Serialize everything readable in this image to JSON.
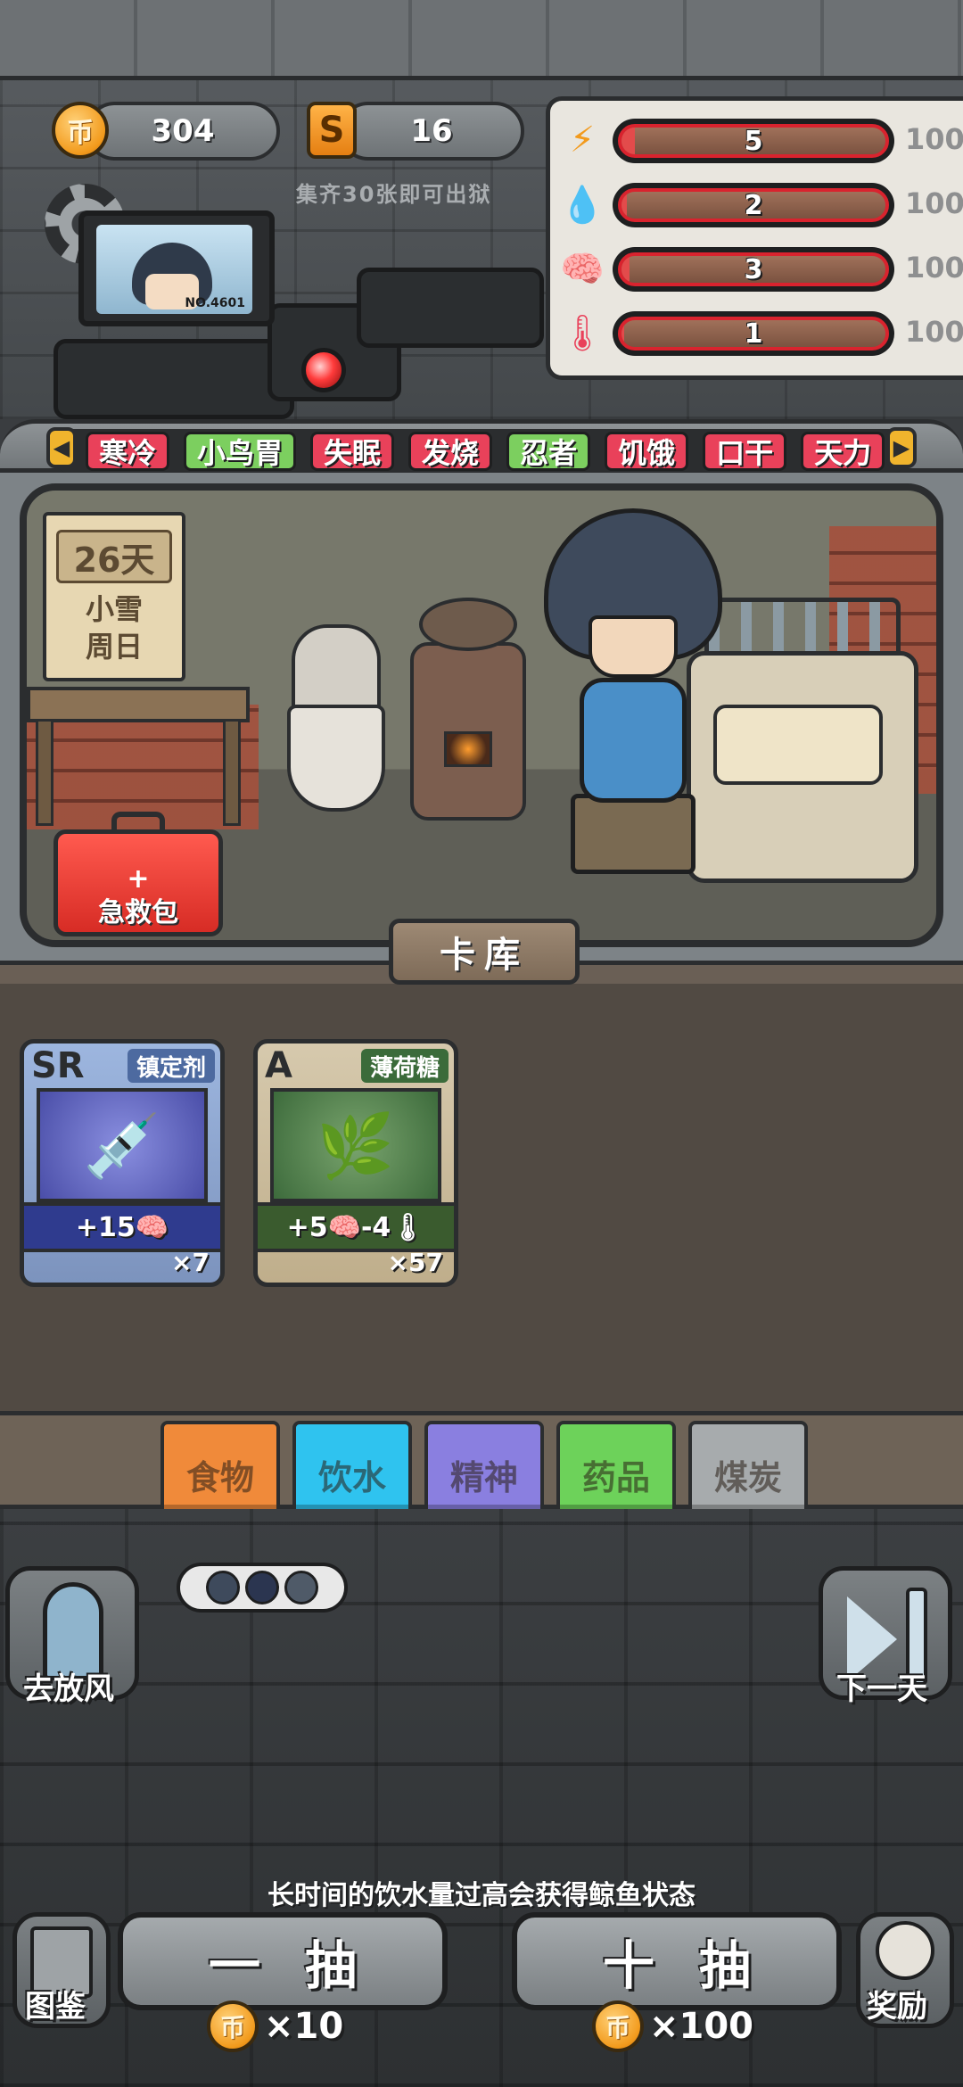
{
  "currency": {
    "coins": "304",
    "coin_icon_glyph": "币",
    "tickets": "16",
    "ticket_icon_glyph": "S",
    "hint": "集齐30张即可出狱"
  },
  "monitor": {
    "id_label": "NO.4601"
  },
  "stats": [
    {
      "icon": "lightning-icon",
      "glyph": "⚡",
      "color": "#f29a1c",
      "value": "5",
      "max": "100",
      "fraction": 0.05
    },
    {
      "icon": "water-drop-icon",
      "glyph": "💧",
      "color": "#3a8fd9",
      "value": "2",
      "max": "100",
      "fraction": 0.02
    },
    {
      "icon": "brain-icon",
      "glyph": "🧠",
      "color": "#8a7fe0",
      "value": "3",
      "max": "100",
      "fraction": 0.03
    },
    {
      "icon": "thermometer-icon",
      "glyph": "🌡",
      "color": "#e9415a",
      "value": "1",
      "max": "100",
      "fraction": 0.01
    }
  ],
  "status_effects": [
    {
      "label": "寒冷",
      "color": "red"
    },
    {
      "label": "小鸟胃",
      "color": "green"
    },
    {
      "label": "失眠",
      "color": "red"
    },
    {
      "label": "发烧",
      "color": "red"
    },
    {
      "label": "忍者",
      "color": "green"
    },
    {
      "label": "饥饿",
      "color": "red"
    },
    {
      "label": "口干",
      "color": "red"
    },
    {
      "label": "天力",
      "color": "red"
    }
  ],
  "calendar": {
    "day": "26天",
    "weather": "小雪",
    "weekday": "周日"
  },
  "first_aid": {
    "plus": "+",
    "label": "急救包"
  },
  "card_library_tab": "卡库",
  "cards": [
    {
      "rank": "SR",
      "name": "镇定剂",
      "effect": "+15🧠",
      "count": "×7",
      "art": "💉"
    },
    {
      "rank": "A",
      "name": "薄荷糖",
      "effect": "+5🧠-4🌡",
      "count": "×57",
      "art": "🌿"
    }
  ],
  "categories": [
    {
      "label": "食物",
      "color": "#f08a3a"
    },
    {
      "label": "饮水",
      "color": "#2fc3ef"
    },
    {
      "label": "精神",
      "color": "#8a7fe0"
    },
    {
      "label": "药品",
      "color": "#6dd25a"
    },
    {
      "label": "煤炭",
      "color": "#a7abad"
    }
  ],
  "bottom": {
    "ventilate_label": "去放风",
    "next_day_label": "下一天",
    "tip": "长时间的饮水量过高会获得鲸鱼状态",
    "single_draw_label": "一抽",
    "single_draw_cost": "×10",
    "ten_draw_label": "十抽",
    "ten_draw_cost": "×100",
    "catalog_label": "图鉴",
    "reward_label": "奖励"
  }
}
